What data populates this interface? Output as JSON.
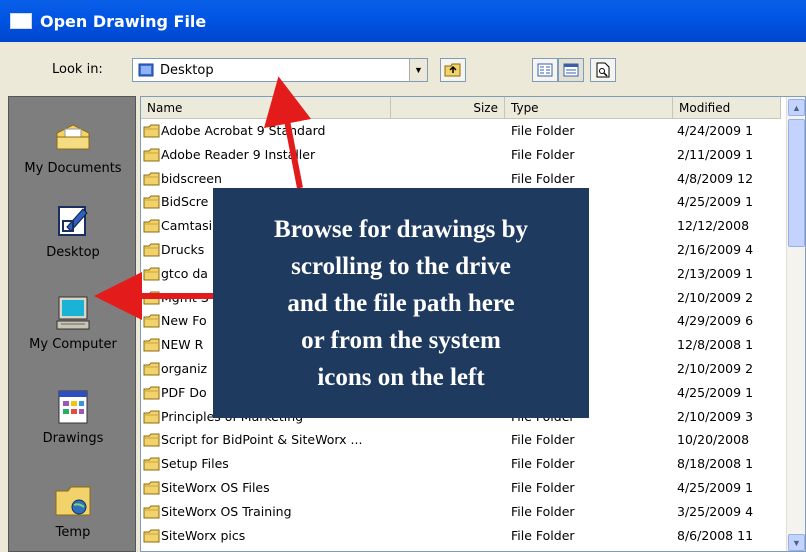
{
  "window": {
    "title": "Open Drawing File"
  },
  "lookin": {
    "label": "Look in:",
    "value": "Desktop"
  },
  "places": [
    {
      "label": "My Documents",
      "icon": "my-documents-icon"
    },
    {
      "label": "Desktop",
      "icon": "desktop-icon"
    },
    {
      "label": "My Computer",
      "icon": "my-computer-icon"
    },
    {
      "label": "Drawings",
      "icon": "drawings-icon"
    },
    {
      "label": "Temp",
      "icon": "temp-folder-icon"
    }
  ],
  "columns": {
    "name": "Name",
    "size": "Size",
    "type": "Type",
    "modified": "Modified"
  },
  "files": [
    {
      "name": "Adobe Acrobat 9 Standard",
      "type": "File Folder",
      "modified": "4/24/2009 1"
    },
    {
      "name": "Adobe Reader 9 Installer",
      "type": "File Folder",
      "modified": "2/11/2009 1"
    },
    {
      "name": "bidscreen",
      "type": "File Folder",
      "modified": "4/8/2009 12"
    },
    {
      "name": "BidScre",
      "type": "",
      "modified": "4/25/2009 1"
    },
    {
      "name": "Camtasi",
      "type": "",
      "modified": "12/12/2008"
    },
    {
      "name": "Drucks",
      "type": "",
      "modified": "2/16/2009 4"
    },
    {
      "name": "gtco da",
      "type": "",
      "modified": "2/13/2009 1"
    },
    {
      "name": "Mgmt S",
      "type": "",
      "modified": "2/10/2009 2"
    },
    {
      "name": "New Fo",
      "type": "",
      "modified": "4/29/2009 6"
    },
    {
      "name": "NEW R",
      "type": "",
      "modified": "12/8/2008 1"
    },
    {
      "name": "organiz",
      "type": "",
      "modified": "2/10/2009 2"
    },
    {
      "name": "PDF Do",
      "type": "",
      "modified": "4/25/2009 1"
    },
    {
      "name": "Principles of Marketing",
      "type": "File Folder",
      "modified": "2/10/2009 3"
    },
    {
      "name": "Script for BidPoint & SiteWorx ...",
      "type": "File Folder",
      "modified": "10/20/2008"
    },
    {
      "name": "Setup Files",
      "type": "File Folder",
      "modified": "8/18/2008 1"
    },
    {
      "name": "SiteWorx OS Files",
      "type": "File Folder",
      "modified": "4/25/2009 1"
    },
    {
      "name": "SiteWorx OS Training",
      "type": "File Folder",
      "modified": "3/25/2009 4"
    },
    {
      "name": "SiteWorx pics",
      "type": "File Folder",
      "modified": "8/6/2008 11"
    }
  ],
  "callout": {
    "lines": [
      "Browse for drawings by",
      "scrolling to the drive",
      "and the file path here",
      "or from the system",
      "icons on the left"
    ]
  },
  "colors": {
    "titlebar": "#0054E3",
    "callout_bg": "#1F3A5F",
    "arrow": "#E31B1B",
    "places_bg": "#7E7E7E",
    "folder": "#F2D36B"
  }
}
